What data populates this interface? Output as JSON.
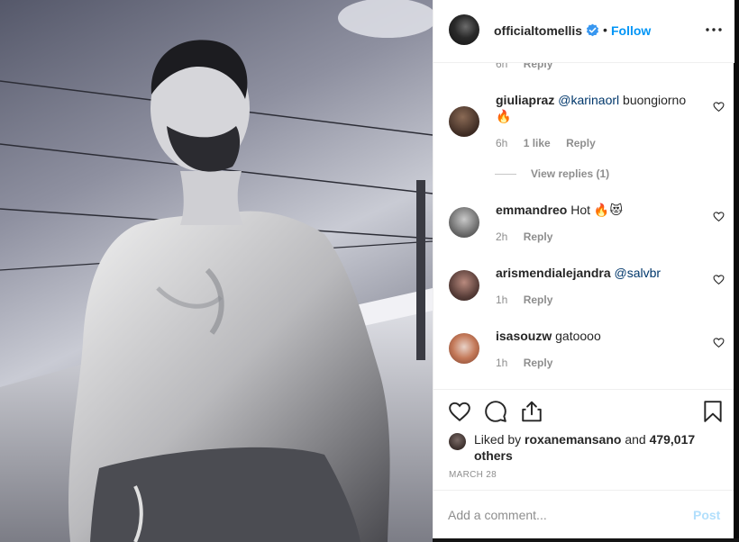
{
  "post": {
    "image_icon": "shirtless-man-photo",
    "author": {
      "username": "officialtomellis",
      "verified_icon": "verified-badge-icon",
      "separator": "•",
      "follow_label": "Follow",
      "more_icon": "more-options-icon"
    },
    "partial_comment": {
      "time": "6h",
      "reply_label": "Reply"
    },
    "comments": [
      {
        "username": "giuliapraz",
        "mention": "@karinaorl",
        "text": "buongiorno 🔥",
        "time": "6h",
        "likes": "1 like",
        "reply_label": "Reply",
        "view_replies": "View replies (1)"
      },
      {
        "username": "emmandreo",
        "mention": "",
        "text": "Hot 🔥😻",
        "time": "2h",
        "reply_label": "Reply"
      },
      {
        "username": "arismendialejandra",
        "mention": "@salvbr",
        "text": "",
        "time": "1h",
        "reply_label": "Reply"
      },
      {
        "username": "isasouzw",
        "mention": "",
        "text": "gatoooo",
        "time": "1h",
        "reply_label": "Reply"
      }
    ],
    "likes": {
      "prefix": "Liked by",
      "user": "roxanemansano",
      "middle": "and",
      "others": "479,017 others"
    },
    "date": "MARCH 28",
    "add_comment": {
      "placeholder": "Add a comment...",
      "post_label": "Post"
    }
  },
  "colors": {
    "link_blue": "#0095f6",
    "mention_blue": "#00376b",
    "muted": "#8e8e8e",
    "post_disabled": "#b2dffc"
  }
}
